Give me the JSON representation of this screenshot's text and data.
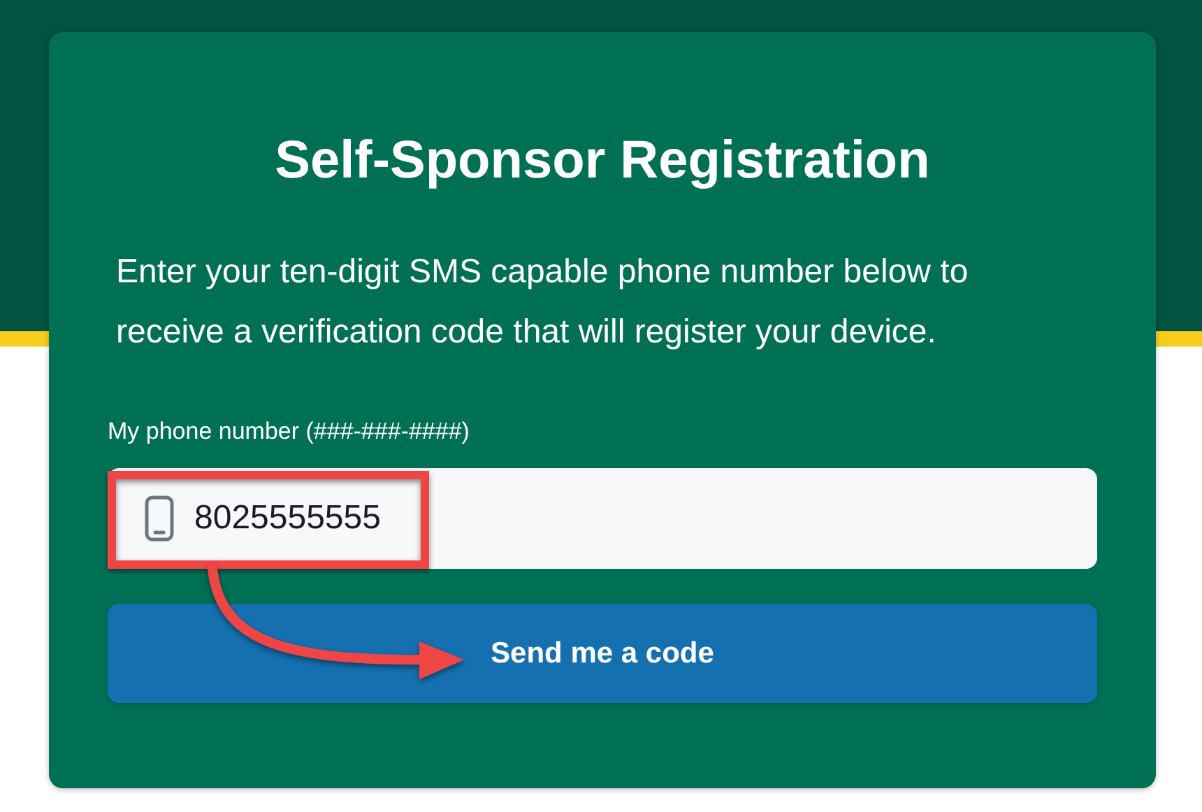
{
  "title": "Self-Sponsor Registration",
  "instructions": "Enter your ten-digit SMS capable phone number below to receive a verification code that will register your device.",
  "phone_field": {
    "label": "My phone number (###-###-####)",
    "value": "8025555555"
  },
  "button": {
    "label": "Send me a code"
  }
}
